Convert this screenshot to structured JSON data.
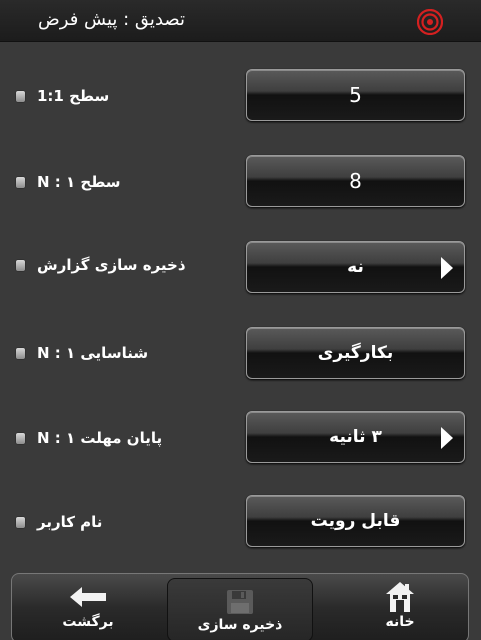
{
  "header": {
    "title": "تصدیق : پیش فرض",
    "logo_icon": "target-logo-icon"
  },
  "settings": [
    {
      "label": "سطح 1:1",
      "value": "5",
      "has_arrow": false
    },
    {
      "label": "سطح N : ۱",
      "value": "8",
      "has_arrow": false
    },
    {
      "label": "ذخیره سازی گزارش",
      "value": "نه",
      "has_arrow": true
    },
    {
      "label": "شناسایی N : ۱",
      "value": "بکارگیری",
      "has_arrow": false
    },
    {
      "label": "پایان مهلت N : ۱",
      "value": "۳ ثانیه",
      "has_arrow": true
    },
    {
      "label": "نام کاربر",
      "value": "قابل رویت",
      "has_arrow": false
    }
  ],
  "bottom_nav": {
    "back_label": "برگشت",
    "save_label": "ذخیره سازی",
    "home_label": "خانه"
  },
  "colors": {
    "background": "#3a3a3a",
    "logo_red": "#d42020"
  }
}
